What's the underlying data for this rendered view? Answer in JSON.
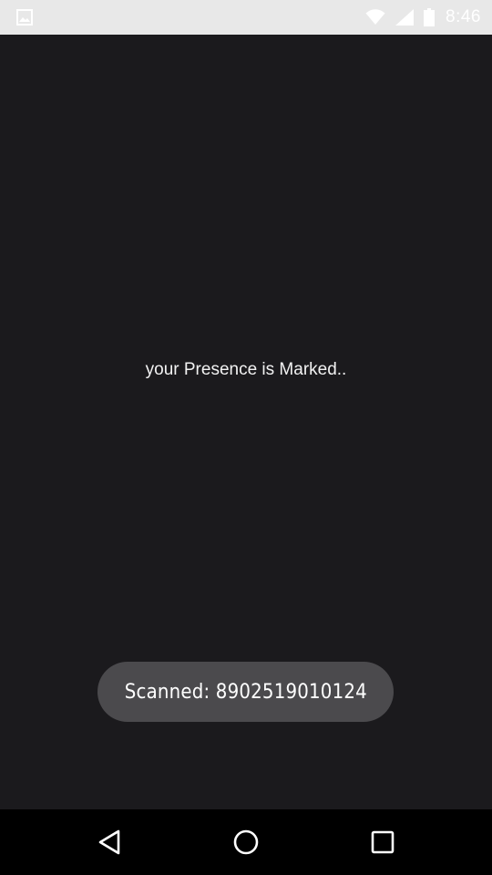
{
  "status_bar": {
    "time": "8:46",
    "icons": [
      "image-notification-icon",
      "wifi-icon",
      "signal-icon",
      "battery-icon"
    ]
  },
  "main": {
    "message": "your Presence is Marked.."
  },
  "toast": {
    "text": "Scanned: 8902519010124"
  },
  "nav_bar": {
    "buttons": [
      "back-icon",
      "home-icon",
      "recents-icon"
    ]
  },
  "colors": {
    "background": "#1b1a1d",
    "status_bar": "#e8e8e8",
    "toast": "#4b4a4d",
    "nav_bar": "#000000"
  }
}
